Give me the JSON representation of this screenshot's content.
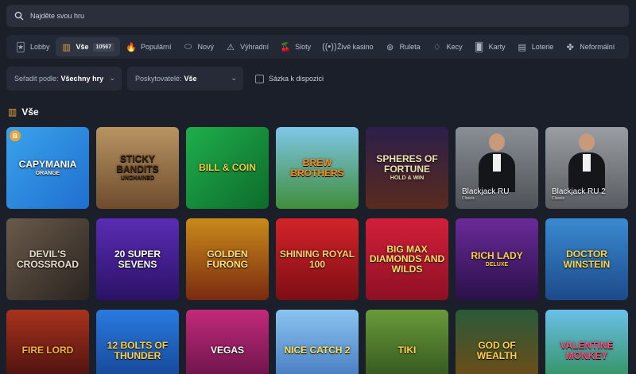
{
  "search": {
    "placeholder": "Najděte svou hru"
  },
  "tabs": [
    {
      "label": "Lobby",
      "icon": "lobby-icon",
      "glyph": "🃏"
    },
    {
      "label": "Vše",
      "icon": "slot-machine-icon",
      "glyph": "▥",
      "badge": "10567",
      "active": true
    },
    {
      "label": "Populární",
      "icon": "flame-icon",
      "glyph": "🔥"
    },
    {
      "label": "Nový",
      "icon": "new-icon",
      "glyph": "⬭"
    },
    {
      "label": "Výhradní",
      "icon": "exclusive-icon",
      "glyph": "⚠"
    },
    {
      "label": "Sloty",
      "icon": "cherries-icon",
      "glyph": "🍒"
    },
    {
      "label": "Živé kasino",
      "icon": "live-icon",
      "glyph": "((•))"
    },
    {
      "label": "Ruleta",
      "icon": "roulette-icon",
      "glyph": "⊛"
    },
    {
      "label": "Kecy",
      "icon": "chat-icon",
      "glyph": "♢"
    },
    {
      "label": "Karty",
      "icon": "cards-icon",
      "glyph": "🂠"
    },
    {
      "label": "Loterie",
      "icon": "lottery-icon",
      "glyph": "▤"
    },
    {
      "label": "Neformální",
      "icon": "clover-icon",
      "glyph": "✤"
    }
  ],
  "filters": {
    "sort_label": "Seřadit podle:",
    "sort_value": "Všechny hry",
    "provider_label": "Poskytovatelé:",
    "provider_value": "Vše",
    "bet_checkbox_label": "Sázka k dispozici"
  },
  "section": {
    "title": "Vše"
  },
  "games": [
    {
      "title": "Capymania",
      "sub": "Orange",
      "bg": "linear-gradient(135deg,#3aa3ea,#1f6fd0)",
      "color": "#ffffff",
      "badge": "B"
    },
    {
      "title": "Sticky Bandits",
      "sub": "Unchained",
      "bg": "linear-gradient(180deg,#b89463,#6e4c2c)",
      "color": "#3a2412"
    },
    {
      "title": "Bill & Coin",
      "bg": "linear-gradient(135deg,#1fae4c,#0d6b2a)",
      "color": "#f2d43a"
    },
    {
      "title": "Brew Brothers",
      "bg": "linear-gradient(180deg,#7fc7e8,#3f8d3a)",
      "color": "#ff8a1a"
    },
    {
      "title": "Spheres of Fortune",
      "sub": "Hold & Win",
      "bg": "linear-gradient(180deg,#2c1f4a,#5a2a1e)",
      "color": "#f3e4b4"
    },
    {
      "live": true,
      "title": "Blackjack RU",
      "sub": "Classic",
      "bg": "linear-gradient(180deg,#8a8f95,#4e5257)"
    },
    {
      "live": true,
      "title": "Blackjack RU 2",
      "sub": "Classic",
      "bg": "linear-gradient(180deg,#9a9ea3,#585c61)"
    },
    {
      "title": "Devil's Crossroad",
      "bg": "linear-gradient(135deg,#6a5a4a,#2a2420)",
      "color": "#e9e0d0"
    },
    {
      "title": "20 Super Sevens",
      "bg": "linear-gradient(180deg,#5a2cb4,#2a1266)",
      "color": "#ffffff"
    },
    {
      "title": "Golden Furong",
      "bg": "linear-gradient(180deg,#c98a1a,#7a2a10)",
      "color": "#ffe27a"
    },
    {
      "title": "Shining Royal 100",
      "bg": "linear-gradient(180deg,#d4232a,#7c0e14)",
      "color": "#ffd36a"
    },
    {
      "title": "Big Max Diamonds and Wilds",
      "bg": "linear-gradient(180deg,#d21f3a,#8e0f24)",
      "color": "#ffe066"
    },
    {
      "title": "Rich Lady",
      "sub": "deluxe",
      "bg": "linear-gradient(180deg,#6a2a9a,#2a1048)",
      "color": "#ffd24a"
    },
    {
      "title": "Doctor Winstein",
      "bg": "linear-gradient(180deg,#3a8ad0,#1c4a8a)",
      "color": "#ffd84a"
    },
    {
      "title": "Fire Lord",
      "bg": "linear-gradient(180deg,#a8321e,#3a0c0c)",
      "color": "#ffb13a"
    },
    {
      "title": "12 Bolts of Thunder",
      "bg": "linear-gradient(180deg,#2a7ae0,#123e8a)",
      "color": "#ffd44a"
    },
    {
      "title": "Vegas",
      "bg": "linear-gradient(180deg,#c22a7a,#5a1040)",
      "color": "#ffffff"
    },
    {
      "title": "Nice Catch 2",
      "bg": "linear-gradient(180deg,#8ac4f0,#3a6fb8)",
      "color": "#ffe25a"
    },
    {
      "title": "Tiki",
      "bg": "linear-gradient(180deg,#6a9a3a,#2a4a1a)",
      "color": "#ffcf4a"
    },
    {
      "title": "God of Wealth",
      "bg": "linear-gradient(180deg,#2a5a3a,#7a4a10)",
      "color": "#ffd24a"
    },
    {
      "title": "Valentine Monkey",
      "bg": "linear-gradient(180deg,#6ac0e8,#2a8a4a)",
      "color": "#ff4a7a"
    }
  ]
}
